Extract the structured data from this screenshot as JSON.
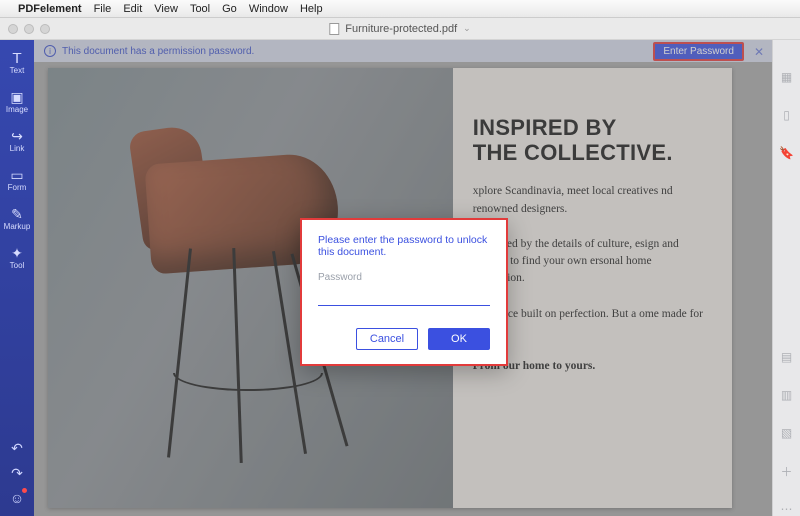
{
  "menubar": {
    "app_name": "PDFelement",
    "items": [
      "File",
      "Edit",
      "View",
      "Tool",
      "Go",
      "Window",
      "Help"
    ]
  },
  "window": {
    "document_title": "Furniture-protected.pdf"
  },
  "left_sidebar": {
    "items": [
      {
        "icon": "text-icon",
        "label": "Text"
      },
      {
        "icon": "image-icon",
        "label": "Image"
      },
      {
        "icon": "link-icon",
        "label": "Link"
      },
      {
        "icon": "form-icon",
        "label": "Form"
      },
      {
        "icon": "markup-icon",
        "label": "Markup"
      },
      {
        "icon": "tool-icon",
        "label": "Tool"
      }
    ]
  },
  "permission_banner": {
    "message": "This document has a permission password.",
    "button_label": "Enter Password"
  },
  "document": {
    "heading_line1": "INSPIRED BY",
    "heading_line2": "THE COLLECTIVE.",
    "para1": "xplore Scandinavia, meet local creatives nd renowned designers.",
    "para2": "e inspired by the details of culture, esign and passion to find your own ersonal home expression.",
    "para3": "ot a space built on perfection. But a ome made for living.",
    "para4": "From our home to yours."
  },
  "dialog": {
    "prompt": "Please enter the password to unlock this document.",
    "field_label": "Password",
    "value": "",
    "cancel_label": "Cancel",
    "ok_label": "OK"
  },
  "colors": {
    "accent": "#3b50e0",
    "highlight_border": "#e23b3b",
    "sidebar_bg": "#2d3a90"
  }
}
